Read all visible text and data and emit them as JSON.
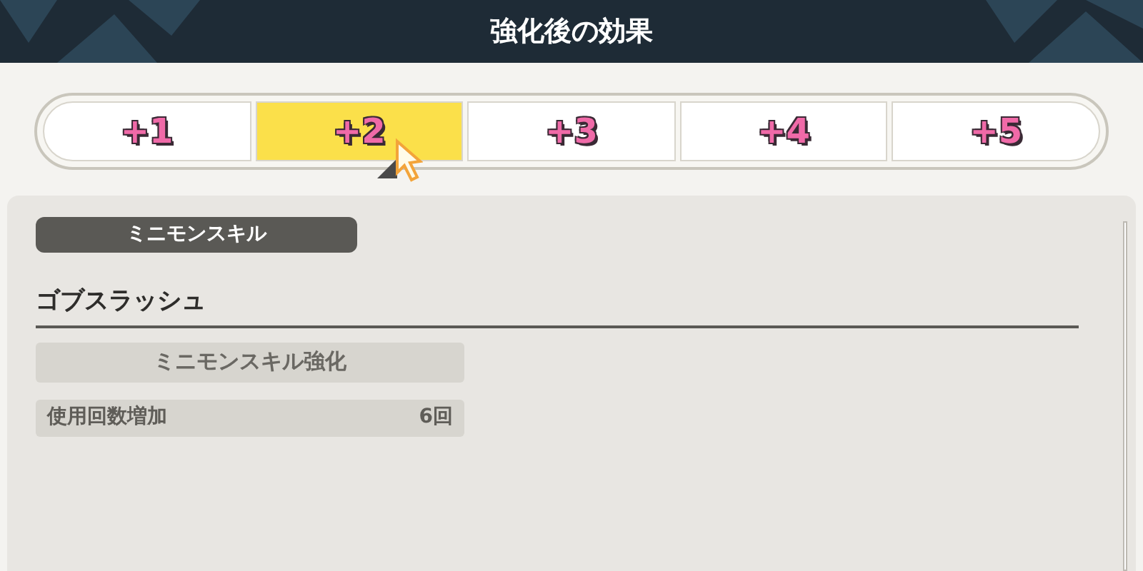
{
  "header": {
    "title": "強化後の効果"
  },
  "tabs": [
    {
      "label": "+1",
      "selected": false
    },
    {
      "label": "+2",
      "selected": true
    },
    {
      "label": "+3",
      "selected": false
    },
    {
      "label": "+4",
      "selected": false
    },
    {
      "label": "+5",
      "selected": false
    }
  ],
  "panel": {
    "category": "ミニモンスキル",
    "skill_name": "ゴブスラッシュ",
    "section_title": "ミニモンスキル強化",
    "effects": [
      {
        "label": "使用回数増加",
        "value": "6回"
      }
    ]
  }
}
